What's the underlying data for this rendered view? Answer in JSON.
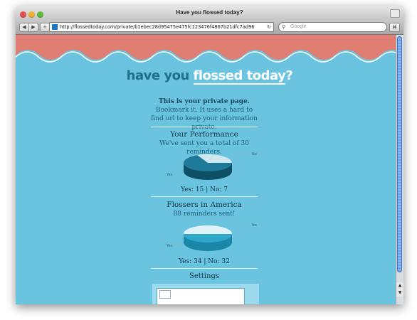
{
  "window": {
    "title": "Have you flossed today?"
  },
  "toolbar": {
    "back": "◀",
    "forward": "▶",
    "add": "+",
    "url": "http://flossedtoday.com/private/b1ebec28d95475e475fc123476f4867b21dfc7ad96",
    "reload": "↻",
    "search_placeholder": "Google",
    "bookmarks": "⌘"
  },
  "logo": {
    "part1": "have you ",
    "part2": "flossed today",
    "part3": "?"
  },
  "intro": {
    "bold": "This is your private page.",
    "rest": " Bookmark it. It uses a hard to find url to keep your information private."
  },
  "performance": {
    "title": "Your Performance",
    "subtitle": "We've sent you a total of 30 reminders.",
    "pie_no_label": "No",
    "pie_yes_label": "Yes",
    "stats": "Yes: 15 | No: 7"
  },
  "america": {
    "title": "Flossers in America",
    "subtitle": "88 reminders sent!",
    "pie_no_label": "No",
    "pie_yes_label": "Yes",
    "stats": "Yes: 34 | No: 32"
  },
  "settings": {
    "title": "Settings"
  },
  "colors": {
    "page_bg": "#6ac4df",
    "wave": "#e07e73",
    "pie_dark": "#1d7a98",
    "pie_light": "#cfe8f0"
  }
}
